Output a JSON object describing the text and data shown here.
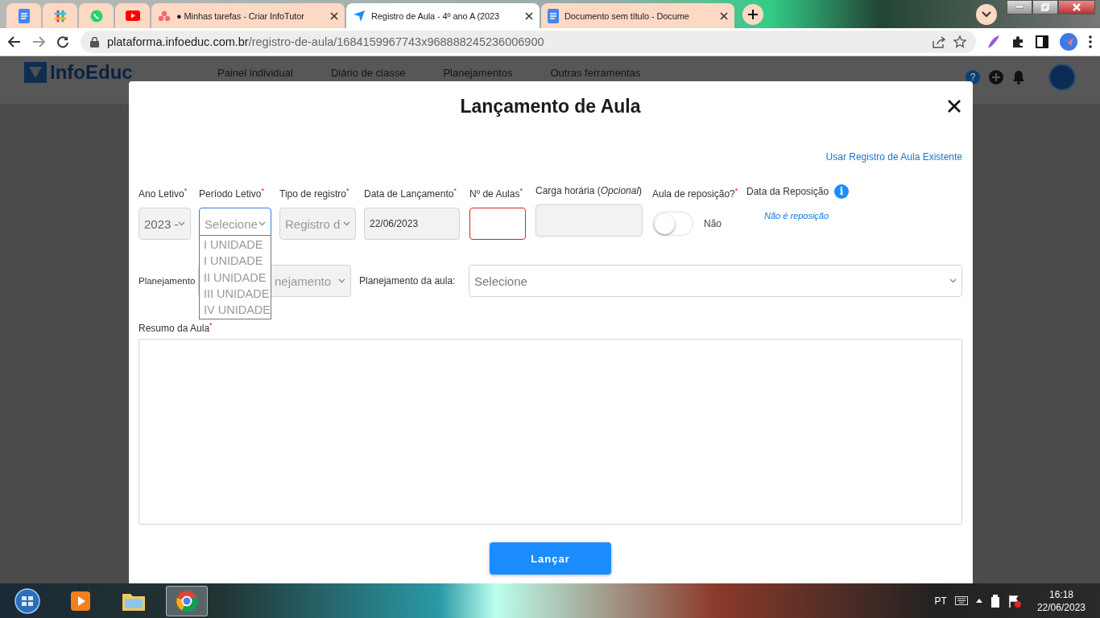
{
  "browser": {
    "tabs": [
      {
        "kind": "pinned",
        "selected": false
      },
      {
        "kind": "pinned",
        "selected": false
      },
      {
        "kind": "pinned",
        "selected": false
      },
      {
        "kind": "pinned",
        "selected": false
      },
      {
        "kind": "page",
        "title": "● Minhas tarefas - Criar InfoTutor",
        "selected": false
      },
      {
        "kind": "page",
        "title": "Registro de Aula - 4º ano A (2023",
        "selected": true
      },
      {
        "kind": "page",
        "title": "Documento sem título - Docume",
        "selected": false
      }
    ],
    "address": {
      "host": "plataforma.infoeduc.com.br",
      "path": "/registro-de-aula/1684159967743x968888245236006900"
    }
  },
  "app_header": {
    "logo": "InfoEduc",
    "nav": [
      "Painel individual",
      "Diário de classe",
      "Planejamentos",
      "Outras ferramentas"
    ],
    "help": "?"
  },
  "modal": {
    "title": "Lançamento de Aula",
    "link": "Usar Registro de Aula Existente",
    "fields": [
      {
        "kind": "select",
        "label": "Ano Letivo$^{*}$",
        "value": "2023 -",
        "disabled": true
      },
      {
        "kind": "select",
        "label": "Período Letivo$^{*}$",
        "placeholder": "Selecione",
        "disabled": false,
        "focused": true,
        "expanded": true,
        "options": [
          "I UNIDADE",
          "I UNIDADE",
          "II UNIDADE",
          "III UNIDADE",
          "IV UNIDADE"
        ]
      },
      {
        "kind": "select",
        "label": "Tipo de registro$^{*}$",
        "placeholder": "Registro d",
        "disabled": true
      },
      {
        "kind": "input",
        "label": "Data de Lançamento$^{*}$",
        "value": "22/06/2023",
        "disabled": true
      },
      {
        "kind": "input",
        "label": "Nº de Aulas$^{*}$",
        "invalid": true,
        "disabled": false
      },
      {
        "kind": "input",
        "label": "Carga horária (*Opcional*)",
        "disabled": true
      },
      {
        "kind": "toggle",
        "label": "Aula de reposição?$^{*}$",
        "on": false,
        "text": "Não"
      },
      {
        "kind": "note",
        "label": "Data da Reposição",
        "info": "i",
        "text": "Não é reposição"
      }
    ],
    "planning": [
      {
        "label": "Planejamento",
        "placeholder": "nejamento",
        "disabled": true
      },
      {
        "label": "Planejamento da aula:",
        "placeholder": "Selecione",
        "disabled": false
      }
    ],
    "summary": {
      "label": "Resumo da Aula$^{*}$"
    },
    "submit": "Lançar"
  },
  "taskbar": {
    "language": "PT",
    "time": "16:18",
    "date": "22/06/2023"
  }
}
